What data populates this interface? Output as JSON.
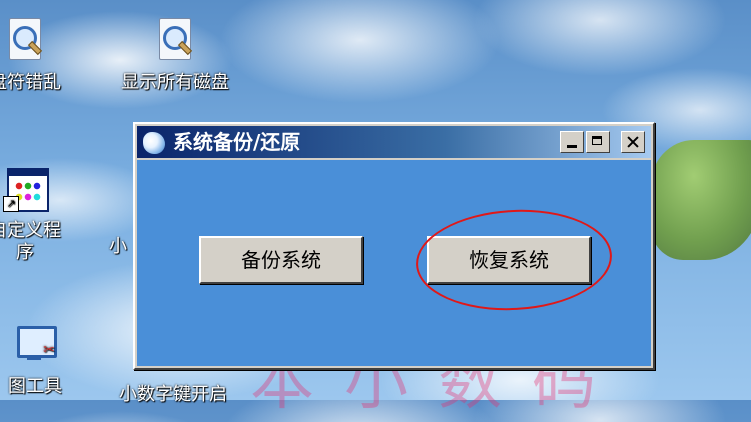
{
  "desktop": {
    "icons": [
      {
        "label_lines": [
          "盘符错乱"
        ],
        "icon": "magnifier-doc-icon"
      },
      {
        "label_lines": [
          "显示所有磁盘"
        ],
        "icon": "magnifier-doc-icon"
      },
      {
        "label_lines": [
          "自定义程",
          "序"
        ],
        "icon": "program-window-icon"
      },
      {
        "label_lines": [
          "小"
        ],
        "icon": "shortcut-icon"
      },
      {
        "label_lines": [
          "图工具"
        ],
        "icon": "monitor-icon"
      },
      {
        "label_lines": [
          "小数字键开启"
        ],
        "icon": "shortcut-icon"
      }
    ],
    "watermark": "本小数码"
  },
  "window": {
    "title": "系统备份/还原",
    "title_icon": "app-icon",
    "controls": {
      "minimize": "minimize-icon",
      "maximize": "maximize-icon",
      "close": "close-icon"
    },
    "buttons": {
      "backup_label": "备份系统",
      "restore_label": "恢复系统"
    },
    "highlight_color": "#e01818"
  },
  "colors": {
    "client_bg": "#4a8fd8",
    "titlebar_start": "#0a246a",
    "titlebar_end": "#a6caf0",
    "button_face": "#d4d0c8"
  }
}
